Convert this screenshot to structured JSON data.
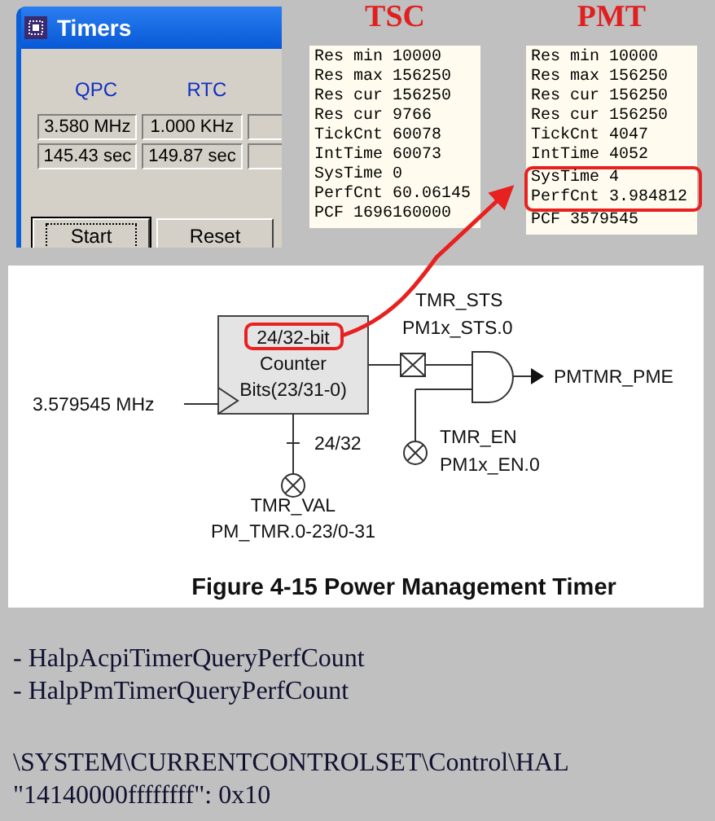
{
  "timers_window": {
    "title": "Timers",
    "columns": [
      "QPC",
      "RTC"
    ],
    "rows": [
      [
        "3.580 MHz",
        "1.000 KHz"
      ],
      [
        "145.43 sec",
        "149.87 sec"
      ]
    ],
    "buttons": [
      {
        "label": "Start",
        "focused": true
      },
      {
        "label": "Reset",
        "focused": false
      }
    ]
  },
  "panels": [
    {
      "title": "TSC",
      "lines": [
        {
          "text": "Res min 10000",
          "highlighted": false
        },
        {
          "text": "Res max 156250",
          "highlighted": false
        },
        {
          "text": "Res cur 156250",
          "highlighted": false
        },
        {
          "text": "Res cur 9766",
          "highlighted": false
        },
        {
          "text": "TickCnt 60078",
          "highlighted": false
        },
        {
          "text": "IntTime 60073",
          "highlighted": false
        },
        {
          "text": "SysTime 0",
          "highlighted": false
        },
        {
          "text": "PerfCnt 60.06145",
          "highlighted": false
        },
        {
          "text": "PCF 1696160000",
          "highlighted": false
        }
      ]
    },
    {
      "title": "PMT",
      "lines": [
        {
          "text": "Res min 10000",
          "highlighted": false
        },
        {
          "text": "Res max 156250",
          "highlighted": false
        },
        {
          "text": "Res cur 156250",
          "highlighted": false
        },
        {
          "text": "Res cur 156250",
          "highlighted": false
        },
        {
          "text": "TickCnt 4047",
          "highlighted": false
        },
        {
          "text": "IntTime 4052",
          "highlighted": false
        },
        {
          "text": "SysTime 4",
          "highlighted": true
        },
        {
          "text": "PerfCnt 3.984812",
          "highlighted": true
        },
        {
          "text": "PCF 3579545",
          "highlighted": false
        }
      ]
    }
  ],
  "diagram": {
    "counter_lines": [
      "24/32-bit",
      "Counter",
      "Bits(23/31-0)"
    ],
    "counter_highlighted": true,
    "input": "3.579545 MHz",
    "status": [
      "TMR_STS",
      "PM1x_STS.0"
    ],
    "output": "PMTMR_PME",
    "enable": [
      "TMR_EN",
      "PM1x_EN.0"
    ],
    "width": "24/32",
    "value": [
      "TMR_VAL",
      "PM_TMR.0-23/0-31"
    ],
    "caption": "Figure 4-15 Power Management Timer"
  },
  "functions": [
    "- HalpAcpiTimerQueryPerfCount",
    "- HalpPmTimerQueryPerfCount"
  ],
  "registry": [
    "\\SYSTEM\\CURRENTCONTROLSET\\Control\\HAL",
    "\"14140000ffffffff\": 0x10"
  ]
}
